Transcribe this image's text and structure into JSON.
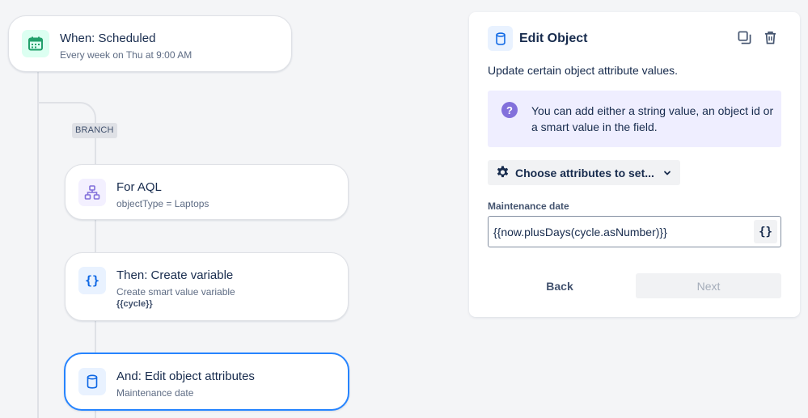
{
  "flow": {
    "trigger": {
      "title": "When: Scheduled",
      "subtitle": "Every week on Thu at 9:00 AM",
      "icon": "calendar-icon"
    },
    "branch_tag": "BRANCH",
    "for_aql": {
      "title": "For AQL",
      "subtitle": "objectType = Laptops",
      "icon": "hierarchy-icon"
    },
    "create_variable": {
      "title": "Then: Create variable",
      "subtitle": "Create smart value variable",
      "detail": "{{cycle}}",
      "icon": "curly-braces-icon"
    },
    "edit_object": {
      "title": "And: Edit object attributes",
      "subtitle": "Maintenance date",
      "icon": "database-icon"
    }
  },
  "panel": {
    "title": "Edit Object",
    "description": "Update certain object attribute values.",
    "info_message": "You can add either a string value, an object id or a smart value in the field.",
    "choose_attributes_label": "Choose attributes to set...",
    "field_label": "Maintenance date",
    "field_value": "{{now.plusDays(cycle.asNumber)}}",
    "smart_value_button": "{}",
    "back_label": "Back",
    "next_label": "Next"
  },
  "colors": {
    "accent": "#2684ff",
    "calendar_green": "#22a06b",
    "purple": "#8270db",
    "info_bg": "#efeeff"
  }
}
